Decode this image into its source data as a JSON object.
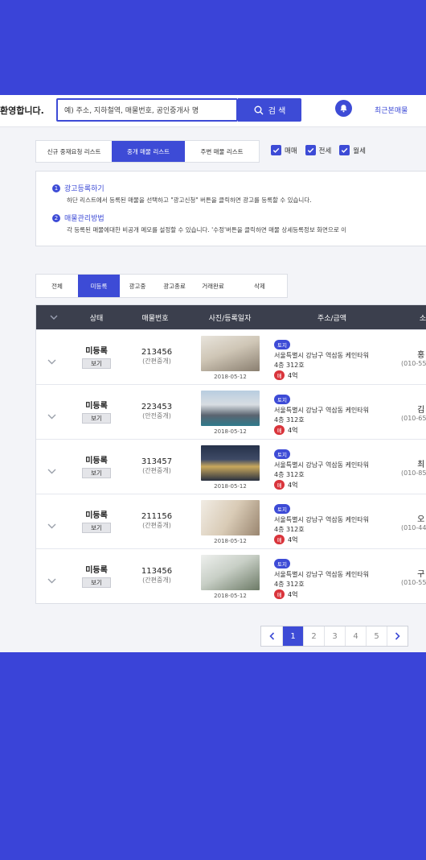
{
  "header": {
    "welcome": "환영합니다.",
    "search_placeholder": "예) 주소, 지하철역, 매물번호, 공인중개사 명",
    "search_button": "검 색",
    "recent_link": "최근본매물"
  },
  "list_tabs": [
    "신규 중재요청 리스트",
    "중개 매물 리스트",
    "주변 매물 리스트"
  ],
  "active_list_tab": 1,
  "filters": [
    "매매",
    "전세",
    "월세"
  ],
  "info": [
    {
      "num": "1",
      "title": "광고등록하기",
      "desc": "하단 리스트에서 등록된 매물을 선택하고 \"광고신청\" 버튼을 클릭하면 광고를 등록할 수 있습니다."
    },
    {
      "num": "2",
      "title": "매물관리방법",
      "desc": "각 등록된 매물에대한 비공개 메모를 설정할 수 있습니다. '수정'버튼을 클릭하면 매물 상세등록정보 화면으로 이"
    }
  ],
  "status_tabs": [
    "전체",
    "미등록",
    "광고중",
    "광고종료",
    "거래완료",
    "삭제"
  ],
  "active_status_tab": 1,
  "table": {
    "headers": [
      "상태",
      "매물번호",
      "사진/등록일자",
      "주소/금액",
      "소"
    ],
    "view_label": "보기",
    "rows": [
      {
        "status": "미등록",
        "num": "213456",
        "type": "(간편중개)",
        "date": "2018-05-12",
        "tag": "토지",
        "addr1": "서울특별시 강남구 역삼동 케인타워",
        "addr2": "4층 312호",
        "price_badge": "매",
        "price": "4억",
        "owner": "홍",
        "phone": "(010-55"
      },
      {
        "status": "미등록",
        "num": "223453",
        "type": "(안전중개)",
        "date": "2018-05-12",
        "tag": "토지",
        "addr1": "서울특별시 강남구 역삼동 케인타워",
        "addr2": "4층 312호",
        "price_badge": "매",
        "price": "4억",
        "owner": "김",
        "phone": "(010-65"
      },
      {
        "status": "미등록",
        "num": "313457",
        "type": "(간편중개)",
        "date": "2018-05-12",
        "tag": "토지",
        "addr1": "서울특별시 강남구 역삼동 케인타워",
        "addr2": "4층 312호",
        "price_badge": "매",
        "price": "4억",
        "owner": "최",
        "phone": "(010-85"
      },
      {
        "status": "미등록",
        "num": "211156",
        "type": "(간편중개)",
        "date": "2018-05-12",
        "tag": "토지",
        "addr1": "서울특별시 강남구 역삼동 케인타워",
        "addr2": "4층 312호",
        "price_badge": "매",
        "price": "4억",
        "owner": "오",
        "phone": "(010-44"
      },
      {
        "status": "미등록",
        "num": "113456",
        "type": "(간편중개)",
        "date": "2018-05-12",
        "tag": "토지",
        "addr1": "서울특별시 강남구 역삼동 케인타워",
        "addr2": "4층 312호",
        "price_badge": "매",
        "price": "4억",
        "owner": "구",
        "phone": "(010-55"
      }
    ]
  },
  "pagination": {
    "prev": "‹",
    "pages": [
      "1",
      "2",
      "3",
      "4",
      "5"
    ],
    "active": 0,
    "next": "›"
  },
  "colors": {
    "accent": "#3d4bd6",
    "background": "#3a44d8",
    "table_header": "#3b3f4d",
    "price_badge": "#d9343b"
  }
}
